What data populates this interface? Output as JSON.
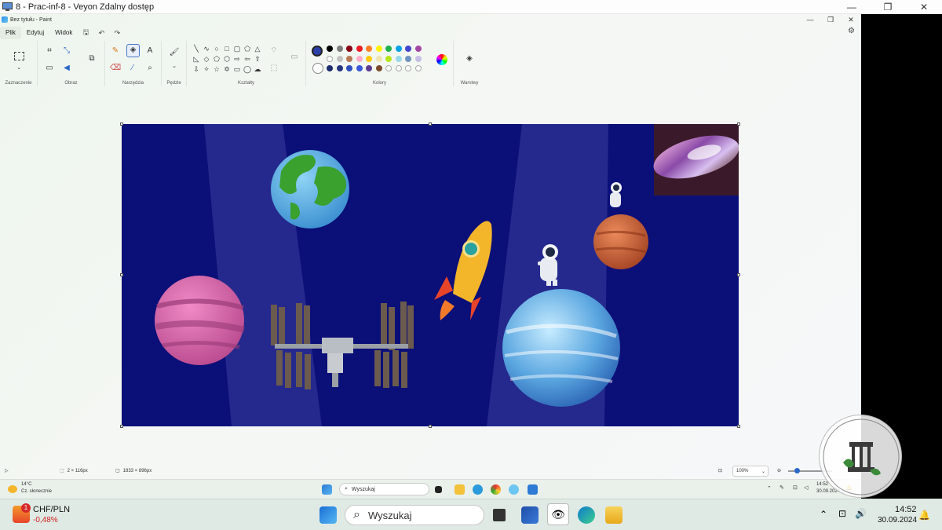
{
  "outer_window": {
    "title": "8 - Prac-inf-8 - Veyon Zdalny dostęp",
    "min": "—",
    "max": "❐",
    "close": "✕"
  },
  "paint": {
    "title": "Bez tytułu - Paint",
    "menu": {
      "file": "Plik",
      "edit": "Edytuj",
      "view": "Widok"
    },
    "groups": {
      "selection": "Zaznaczenie",
      "image": "Obraz",
      "tools": "Narzędzia",
      "brushes": "Pędzle",
      "shapes": "Kształty",
      "colors": "Kolory",
      "layers": "Warstwy"
    },
    "palette": [
      "#000000",
      "#7f7f7f",
      "#880015",
      "#ed1c24",
      "#ff7f27",
      "#fff200",
      "#22b14c",
      "#00a2e8",
      "#3f48cc",
      "#a349a4",
      "#ffffff",
      "#c3c3c3",
      "#b97a57",
      "#ffaec9",
      "#ffc90e",
      "#efe4b0",
      "#b5e61d",
      "#99d9ea",
      "#7092be",
      "#c8bfe7",
      "#1d2d6b",
      "#27357e",
      "#2f4fbf",
      "#3a58d8",
      "#5b3a8f",
      "#7a4a2a",
      "#ffffff",
      "#ffffff",
      "#ffffff",
      "#ffffff"
    ],
    "primary_color": "#2c3fa8",
    "status": {
      "selection": "2 × 116px",
      "canvas_size": "1833 × 896px",
      "zoom": "100%"
    }
  },
  "inner_taskbar": {
    "weather_temp": "14°C",
    "weather_desc": "Cz. słonecznie",
    "search": "Wyszukaj",
    "time": "14:52",
    "date": "30.09.2024"
  },
  "outer_taskbar": {
    "stock_name": "CHF/PLN",
    "stock_change": "-0,48%",
    "badge": "1",
    "search": "Wyszukaj",
    "time": "14:52",
    "date": "30.09.2024"
  }
}
